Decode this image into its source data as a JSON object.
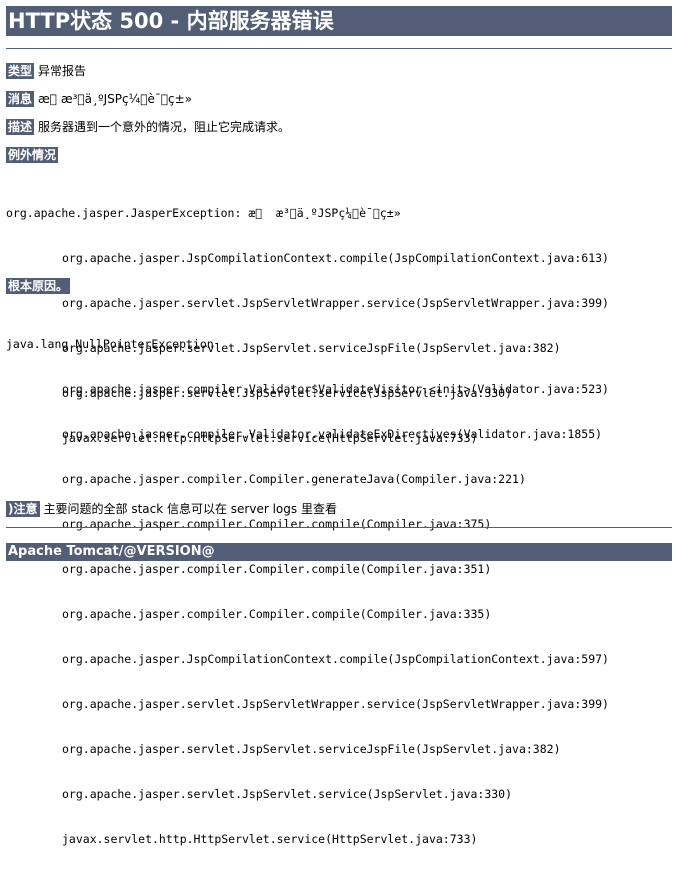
{
  "page": {
    "title": "HTTP状态 500 - 内部服务器错误",
    "footer": "Apache Tomcat/@VERSION@"
  },
  "report": {
    "type_label": "类型",
    "type_value": "异常报告",
    "message_label": "消息",
    "message_value": "æ\u0000 æ³\u0000ä¸ºJSPç¼\u0000è¯\u0000ç±»",
    "description_label": "描述",
    "description_value": "服务器遇到一个意外的情况，阻止它完成请求。",
    "exception_heading": "例外情况",
    "exception_first_line": "org.apache.jasper.JasperException: æ\u0000  æ³\u0000ä¸ºJSPç¼\u0000è¯\u0000ç±»",
    "exception_frames": [
      "org.apache.jasper.JspCompilationContext.compile(JspCompilationContext.java:613)",
      "org.apache.jasper.servlet.JspServletWrapper.service(JspServletWrapper.java:399)",
      "org.apache.jasper.servlet.JspServlet.serviceJspFile(JspServlet.java:382)",
      "org.apache.jasper.servlet.JspServlet.service(JspServlet.java:330)",
      "javax.servlet.http.HttpServlet.service(HttpServlet.java:733)"
    ],
    "root_cause_heading": "根本原因。",
    "root_cause_first_line": "java.lang.NullPointerException",
    "root_cause_frames": [
      "org.apache.jasper.compiler.Validator$ValidateVisitor.<init>(Validator.java:523)",
      "org.apache.jasper.compiler.Validator.validateExDirectives(Validator.java:1855)",
      "org.apache.jasper.compiler.Compiler.generateJava(Compiler.java:221)",
      "org.apache.jasper.compiler.Compiler.compile(Compiler.java:375)",
      "org.apache.jasper.compiler.Compiler.compile(Compiler.java:351)",
      "org.apache.jasper.compiler.Compiler.compile(Compiler.java:335)",
      "org.apache.jasper.JspCompilationContext.compile(JspCompilationContext.java:597)",
      "org.apache.jasper.servlet.JspServletWrapper.service(JspServletWrapper.java:399)",
      "org.apache.jasper.servlet.JspServlet.serviceJspFile(JspServlet.java:382)",
      "org.apache.jasper.servlet.JspServlet.service(JspServlet.java:330)",
      "javax.servlet.http.HttpServlet.service(HttpServlet.java:733)"
    ],
    "note_label": ")注意",
    "note_value": "主要问题的全部 stack 信息可以在 server logs 里查看"
  },
  "colors": {
    "bar_background": "#525d76",
    "bar_text": "#ffffff",
    "body_text": "#000000",
    "page_background": "#ffffff"
  }
}
